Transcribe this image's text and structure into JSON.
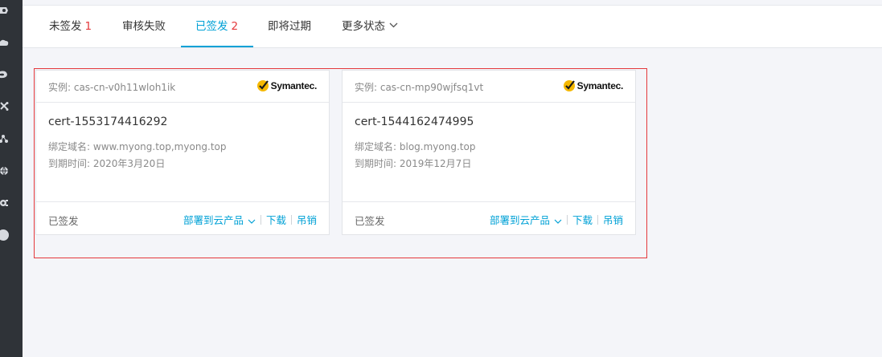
{
  "tabs": [
    {
      "label": "未签发",
      "count": "1"
    },
    {
      "label": "审核失败",
      "count": ""
    },
    {
      "label": "已签发",
      "count": "2"
    },
    {
      "label": "即将过期",
      "count": ""
    },
    {
      "label": "更多状态",
      "count": ""
    }
  ],
  "active_tab_index": 2,
  "brand_name": "Symantec.",
  "colors": {
    "accent": "#00a1d6",
    "count_red": "#e4393c",
    "highlight_border": "#e4393c",
    "brand_check": "#f5b800"
  },
  "cards": [
    {
      "instance": "实例: cas-cn-v0h11wloh1ik",
      "cert_name": "cert-1553174416292",
      "domain_label": "绑定域名:",
      "domain_value": "www.myong.top,myong.top",
      "expire_label": "到期时间:",
      "expire_value": "2020年3月20日",
      "status": "已签发",
      "deploy": "部署到云产品",
      "download": "下载",
      "revoke": "吊销"
    },
    {
      "instance": "实例: cas-cn-mp90wjfsq1vt",
      "cert_name": "cert-1544162474995",
      "domain_label": "绑定域名:",
      "domain_value": "blog.myong.top",
      "expire_label": "到期时间:",
      "expire_value": "2019年12月7日",
      "status": "已签发",
      "deploy": "部署到云产品",
      "download": "下载",
      "revoke": "吊销"
    }
  ],
  "rail_icons": [
    "settings-icon",
    "cloud-icon",
    "refresh-icon",
    "network-icon",
    "share-icon",
    "globe-icon",
    "gear-icon",
    "circle-icon"
  ]
}
